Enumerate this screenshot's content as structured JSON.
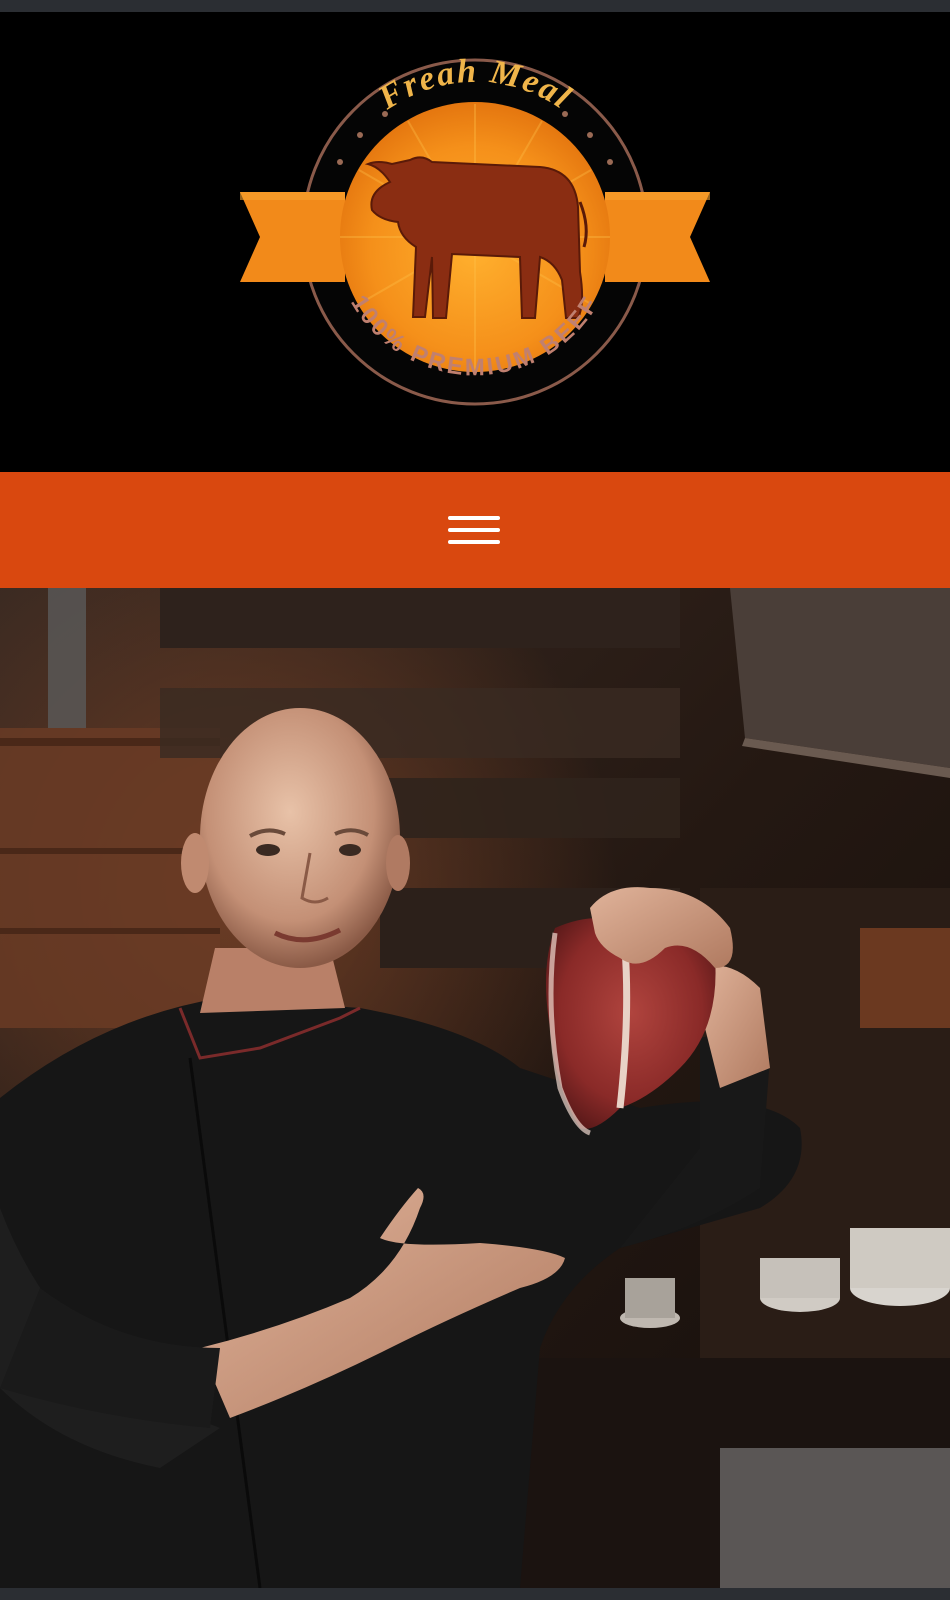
{
  "logo": {
    "brand_top_text": "Freah Meal",
    "brand_bottom_text": "100% PREMIUM BEEF",
    "icon": "cow-icon"
  },
  "nav": {
    "menu_icon": "hamburger-menu-icon"
  },
  "hero": {
    "image": "chef-holding-raw-steak-photo"
  },
  "colors": {
    "nav_bar": "#d9480f",
    "header_bg": "#000000",
    "logo_orange": "#f28a1a",
    "logo_brown": "#8a2d12"
  }
}
